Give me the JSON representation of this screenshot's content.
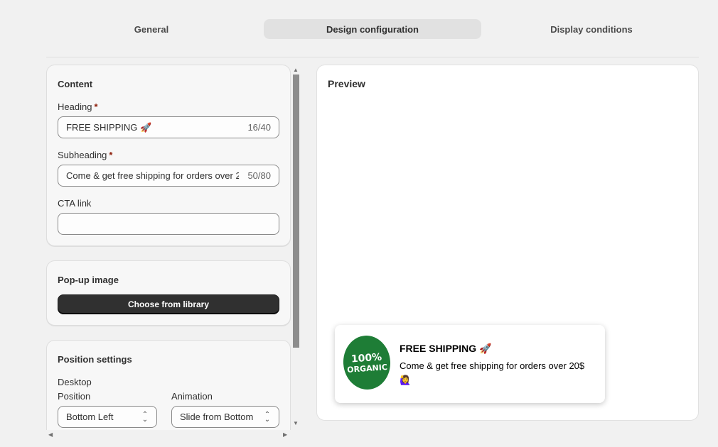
{
  "tabs": [
    {
      "label": "General"
    },
    {
      "label": "Design configuration"
    },
    {
      "label": "Display conditions"
    }
  ],
  "content": {
    "title": "Content",
    "heading_label": "Heading",
    "heading_value": "FREE SHIPPING 🚀",
    "heading_count": "16/40",
    "subheading_label": "Subheading",
    "subheading_value": "Come & get free shipping for orders over 20$ 🙋‍♀️",
    "subheading_count": "50/80",
    "cta_label": "CTA link",
    "cta_value": "",
    "required_mark": "*"
  },
  "popup_image": {
    "title": "Pop-up image",
    "button_label": "Choose from library"
  },
  "position": {
    "title": "Position settings",
    "device_label": "Desktop",
    "position_label": "Position",
    "position_value": "Bottom Left",
    "animation_label": "Animation",
    "animation_value": "Slide from Bottom"
  },
  "preview": {
    "title": "Preview",
    "popup_heading": "FREE SHIPPING 🚀",
    "popup_subheading": "Come & get free shipping for orders over 20$ 🙋‍♀️",
    "badge_line1": "100%",
    "badge_line2": "ORGANIC"
  },
  "colors": {
    "primary_button": "#303030",
    "badge_green": "#1e7d36",
    "required": "#8e1f0b"
  }
}
